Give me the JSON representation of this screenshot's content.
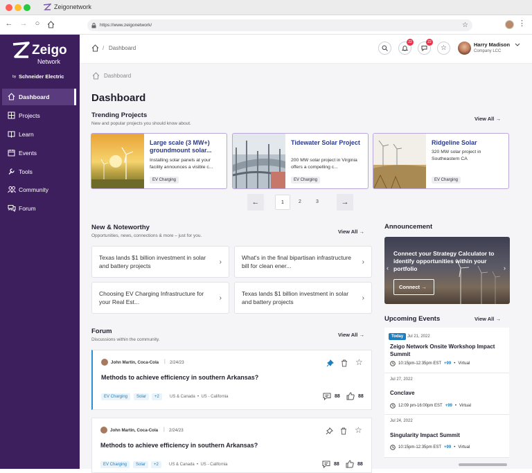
{
  "browser": {
    "tab_title": "Zeigonetwork",
    "url": "https://www.zeigonetwork/"
  },
  "sidebar": {
    "logo": {
      "brand": "Zeigo",
      "sub": "Network",
      "by": "by",
      "company": "Schneider Electric"
    },
    "items": [
      {
        "label": "Dashboard",
        "icon": "home-icon",
        "active": true
      },
      {
        "label": "Projects",
        "icon": "projects-icon"
      },
      {
        "label": "Learn",
        "icon": "book-icon"
      },
      {
        "label": "Events",
        "icon": "calendar-icon"
      },
      {
        "label": "Tools",
        "icon": "wrench-icon"
      },
      {
        "label": "Community",
        "icon": "people-icon"
      },
      {
        "label": "Forum",
        "icon": "chat-icon"
      }
    ]
  },
  "header": {
    "breadcrumb_sep": "/",
    "breadcrumb": "Dashboard",
    "notif_count": "22",
    "msg_count": "22",
    "user_name": "Harry Madison",
    "user_company": "Company LCC"
  },
  "main": {
    "breadcrumb": "Dashboard",
    "title": "Dashboard",
    "view_all": "View All",
    "trending": {
      "title": "Trending Projects",
      "subtitle": "New and popular projects you should know about.",
      "cards": [
        {
          "title": "Large scale (3 MW+) groundmount solar...",
          "desc": "Installing solar panels at your facility announces a visible c...",
          "tag": "EV Charging"
        },
        {
          "title": "Tidewater Solar Project",
          "desc": "200 MW solar project in Virginia offers a compelling c...",
          "tag": "EV Charging"
        },
        {
          "title": "Ridgeline Solar",
          "desc": "320 MW solar project in Southeastern CA",
          "tag": "EV Charging"
        }
      ],
      "pages": [
        "1",
        "2",
        "3"
      ],
      "current_page": "1"
    },
    "noteworthy": {
      "title": "New & Noteworthy",
      "subtitle": "Opportunities, news, connections & more – just for you.",
      "items": [
        "Texas lands $1 billion investment in solar and battery projects",
        "What's in the final bipartisan infrastructure bill for clean ener...",
        "Choosing EV Charging Infrastructure for your Real Est...",
        "Texas lands $1 billion investment in solar and battery projects"
      ]
    },
    "forum": {
      "title": "Forum",
      "subtitle": "Discussions within the community.",
      "posts": [
        {
          "author": "John Martin, Coca-Cola",
          "date": "2/24/23",
          "title": "Methods to achieve efficiency in southern Arkansas?",
          "tags": [
            "EV Charging",
            "Solar",
            "+2"
          ],
          "location": "US & Canada  •  US - California",
          "comments": "88",
          "likes": "88",
          "pinned": true
        },
        {
          "author": "John Martin, Coca-Cola",
          "date": "2/24/23",
          "title": "Methods to achieve efficiency in southern Arkansas?",
          "tags": [
            "EV Charging",
            "Solar",
            "+2"
          ],
          "location": "US & Canada  •  US - California",
          "comments": "88",
          "likes": "88",
          "pinned": false
        }
      ]
    },
    "announcement": {
      "title": "Announcement",
      "text": "Connect your Strategy Calculator to identify opportunities within your portfolio",
      "button": "Connect"
    },
    "events": {
      "title": "Upcoming Events",
      "today_badge": "Today",
      "items": [
        {
          "date": "Jul 21, 2022",
          "title": "Zeigo Network Onsite Workshop Impact Summit",
          "time": "10:15pm-12:35pm EST",
          "more": "+99",
          "type": "Virtual",
          "today": true
        },
        {
          "date": "Jul 27, 2022",
          "title": "Conclave",
          "time": "12:09 pm-16:00pm EST",
          "more": "+99",
          "type": "Virtual"
        },
        {
          "date": "Jul 24, 2022",
          "title": "Singularity Impact Summit",
          "time": "10:15pm-12:35pm EST",
          "more": "+99",
          "type": "Virtual"
        }
      ]
    }
  }
}
